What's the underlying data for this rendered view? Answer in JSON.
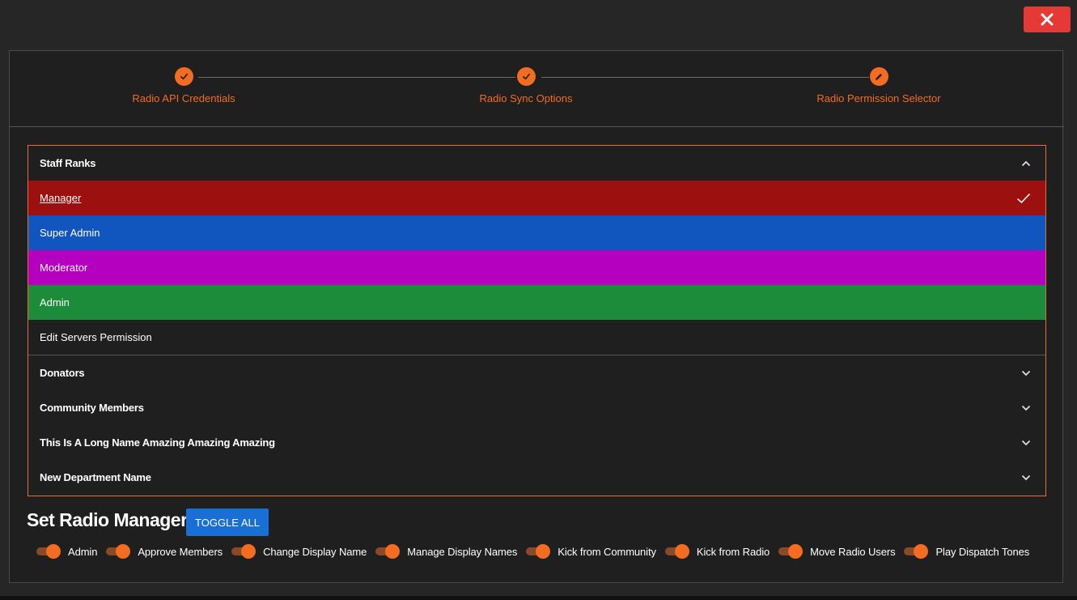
{
  "close_button": {
    "icon": "close-icon"
  },
  "stepper": {
    "steps": [
      {
        "label": "Radio API Credentials",
        "state": "completed",
        "icon": "check-icon"
      },
      {
        "label": "Radio Sync Options",
        "state": "completed",
        "icon": "check-icon"
      },
      {
        "label": "Radio Permission Selector",
        "state": "active",
        "icon": "pencil-icon"
      }
    ]
  },
  "accordion": {
    "groups": [
      {
        "label": "Staff Ranks",
        "expanded": true,
        "items": [
          {
            "label": "Manager",
            "color": "#9c1010",
            "selected": true
          },
          {
            "label": "Super Admin",
            "color": "#1155bf",
            "selected": false
          },
          {
            "label": "Moderator",
            "color": "#b500bf",
            "selected": false
          },
          {
            "label": "Admin",
            "color": "#1d8c3a",
            "selected": false
          },
          {
            "label": "Edit Servers Permission",
            "color": "",
            "selected": false
          }
        ]
      },
      {
        "label": "Donators",
        "expanded": false
      },
      {
        "label": "Community Members",
        "expanded": false
      },
      {
        "label": "This Is A Long Name Amazing Amazing Amazing",
        "expanded": false
      },
      {
        "label": "New Department Name",
        "expanded": false
      }
    ]
  },
  "radio_manager": {
    "title": "Set Radio Manager",
    "toggle_all_label": "TOGGLE ALL",
    "permissions": [
      {
        "label": "Admin",
        "enabled": true
      },
      {
        "label": "Approve Members",
        "enabled": true
      },
      {
        "label": "Change Display Name",
        "enabled": true
      },
      {
        "label": "Manage Display Names",
        "enabled": true
      },
      {
        "label": "Kick from Community",
        "enabled": true
      },
      {
        "label": "Kick from Radio",
        "enabled": true
      },
      {
        "label": "Move Radio Users",
        "enabled": true
      },
      {
        "label": "Play Dispatch Tones",
        "enabled": true
      }
    ]
  },
  "colors": {
    "accent": "#f26c22",
    "close": "#e53935",
    "primary_button": "#1a6fd4"
  }
}
